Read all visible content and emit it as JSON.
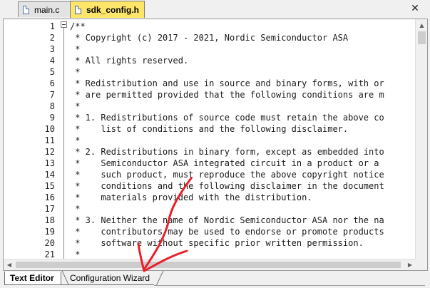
{
  "file_tabs": [
    {
      "label": "main.c",
      "active": false
    },
    {
      "label": "sdk_config.h",
      "active": true
    }
  ],
  "close_glyph": "✕",
  "editor": {
    "lines": [
      {
        "n": "1",
        "text": "/**"
      },
      {
        "n": "2",
        "text": " * Copyright (c) 2017 - 2021, Nordic Semiconductor ASA"
      },
      {
        "n": "3",
        "text": " *"
      },
      {
        "n": "4",
        "text": " * All rights reserved."
      },
      {
        "n": "5",
        "text": " *"
      },
      {
        "n": "6",
        "text": " * Redistribution and use in source and binary forms, with or"
      },
      {
        "n": "7",
        "text": " * are permitted provided that the following conditions are m"
      },
      {
        "n": "8",
        "text": " *"
      },
      {
        "n": "9",
        "text": " * 1. Redistributions of source code must retain the above co"
      },
      {
        "n": "10",
        "text": " *    list of conditions and the following disclaimer."
      },
      {
        "n": "11",
        "text": " *"
      },
      {
        "n": "12",
        "text": " * 2. Redistributions in binary form, except as embedded into"
      },
      {
        "n": "13",
        "text": " *    Semiconductor ASA integrated circuit in a product or a"
      },
      {
        "n": "14",
        "text": " *    such product, must reproduce the above copyright notice"
      },
      {
        "n": "15",
        "text": " *    conditions and the following disclaimer in the document"
      },
      {
        "n": "16",
        "text": " *    materials provided with the distribution."
      },
      {
        "n": "17",
        "text": " *"
      },
      {
        "n": "18",
        "text": " * 3. Neither the name of Nordic Semiconductor ASA nor the na"
      },
      {
        "n": "19",
        "text": " *    contributors may be used to endorse or promote products"
      },
      {
        "n": "20",
        "text": " *    software without specific prior written permission."
      },
      {
        "n": "21",
        "text": " *"
      }
    ]
  },
  "bottom_tabs": [
    {
      "label": "Text Editor",
      "active": true
    },
    {
      "label": "Configuration Wizard",
      "active": false
    }
  ],
  "colors": {
    "active_tab": "#fde56a",
    "annotation_arrow": "#e8222b"
  }
}
